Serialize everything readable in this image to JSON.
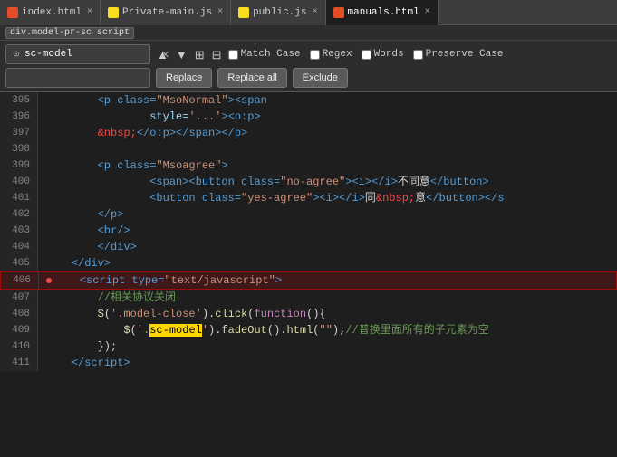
{
  "tabs": [
    {
      "id": "index",
      "label": "index.html",
      "type": "html",
      "active": false
    },
    {
      "id": "private",
      "label": "Private-main.js",
      "type": "js",
      "active": false
    },
    {
      "id": "public",
      "label": "public.js",
      "type": "js",
      "active": false
    },
    {
      "id": "manuals",
      "label": "manuals.html",
      "type": "html",
      "active": true
    }
  ],
  "breadcrumb": "div.model-pr-sc script",
  "find": {
    "search_value": "sc-model",
    "replace_value": "",
    "match_case_label": "Match Case",
    "regex_label": "Regex",
    "words_label": "Words",
    "preserve_case_label": "Preserve Case",
    "replace_btn": "Replace",
    "replace_all_btn": "Replace all",
    "exclude_btn": "Exclude"
  },
  "lines": [
    {
      "num": "395",
      "content": ""
    },
    {
      "num": "396",
      "content": ""
    },
    {
      "num": "397",
      "content": ""
    },
    {
      "num": "398",
      "content": ""
    },
    {
      "num": "399",
      "content": ""
    },
    {
      "num": "400",
      "content": ""
    },
    {
      "num": "401",
      "content": ""
    },
    {
      "num": "402",
      "content": ""
    },
    {
      "num": "403",
      "content": ""
    },
    {
      "num": "404",
      "content": ""
    },
    {
      "num": "405",
      "content": ""
    },
    {
      "num": "406",
      "content": "",
      "highlighted": true
    },
    {
      "num": "407",
      "content": ""
    },
    {
      "num": "408",
      "content": ""
    },
    {
      "num": "409",
      "content": ""
    },
    {
      "num": "410",
      "content": ""
    },
    {
      "num": "411",
      "content": ""
    }
  ]
}
